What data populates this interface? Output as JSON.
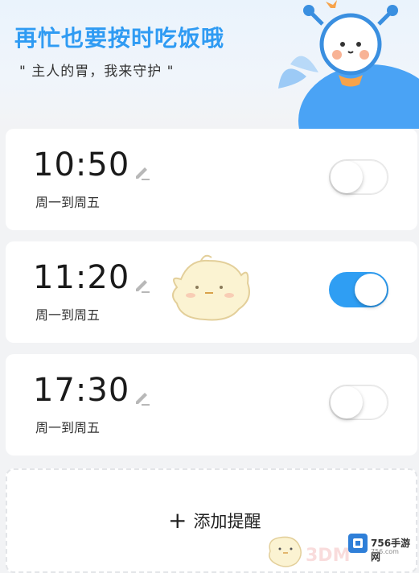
{
  "header": {
    "title": "再忙也要按时吃饭哦",
    "subtitle": "\" 主人的胃，我来守护 \""
  },
  "alarms": [
    {
      "time": "10:50",
      "repeat": "周一到周五",
      "enabled": false
    },
    {
      "time": "11:20",
      "repeat": "周一到周五",
      "enabled": true
    },
    {
      "time": "17:30",
      "repeat": "周一到周五",
      "enabled": false
    }
  ],
  "add_button": {
    "label": "添加提醒"
  },
  "watermark": {
    "brand": "756手游网",
    "url": "756.com",
    "brand2": "3DM"
  },
  "colors": {
    "accent": "#2f9ef3",
    "title": "#2f9bf3"
  }
}
